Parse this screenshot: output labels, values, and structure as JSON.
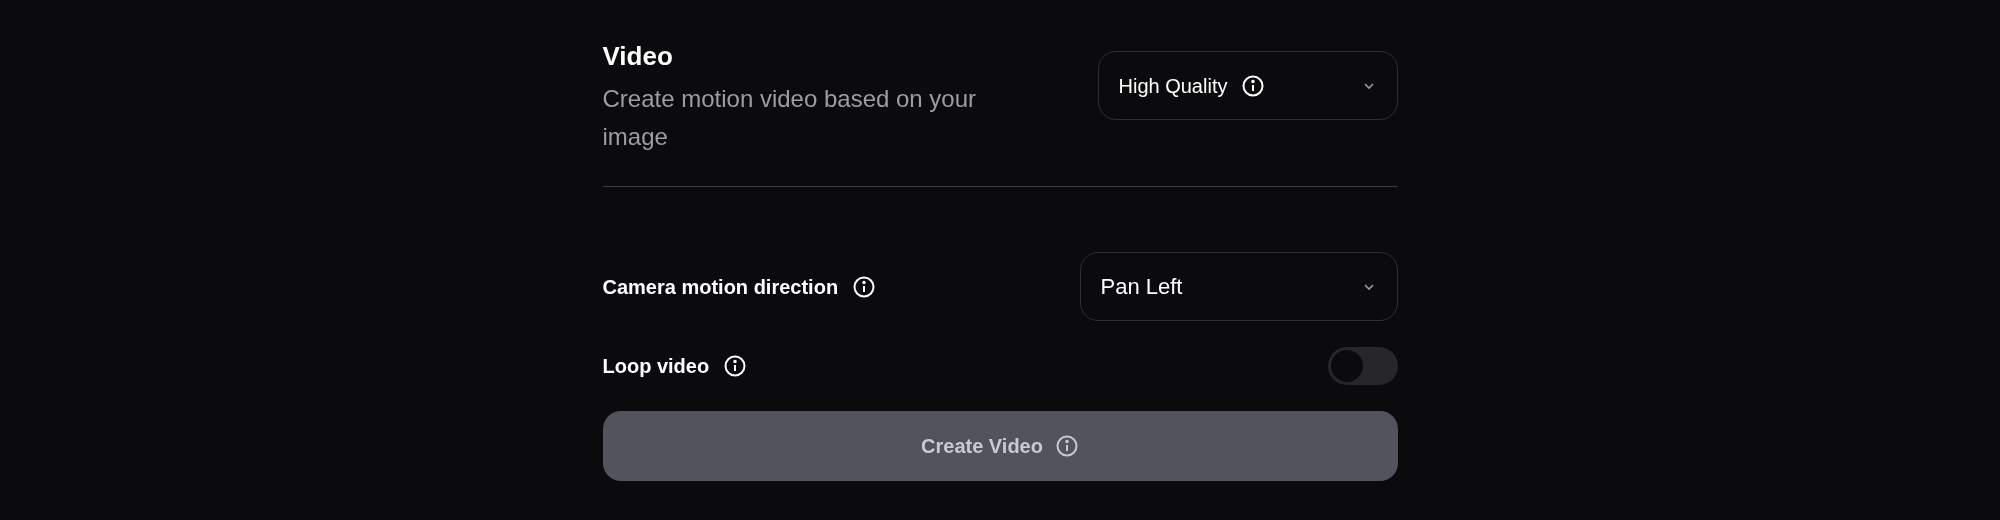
{
  "section": {
    "title": "Video",
    "description": "Create motion video based on your image",
    "quality_select": {
      "value": "High Quality"
    }
  },
  "settings": [
    {
      "kind": "select",
      "label": "Camera motion direction",
      "value": "Pan Left"
    },
    {
      "kind": "toggle",
      "label": "Loop video",
      "on": false
    }
  ],
  "create_button": {
    "label": "Create Video",
    "disabled": true
  }
}
